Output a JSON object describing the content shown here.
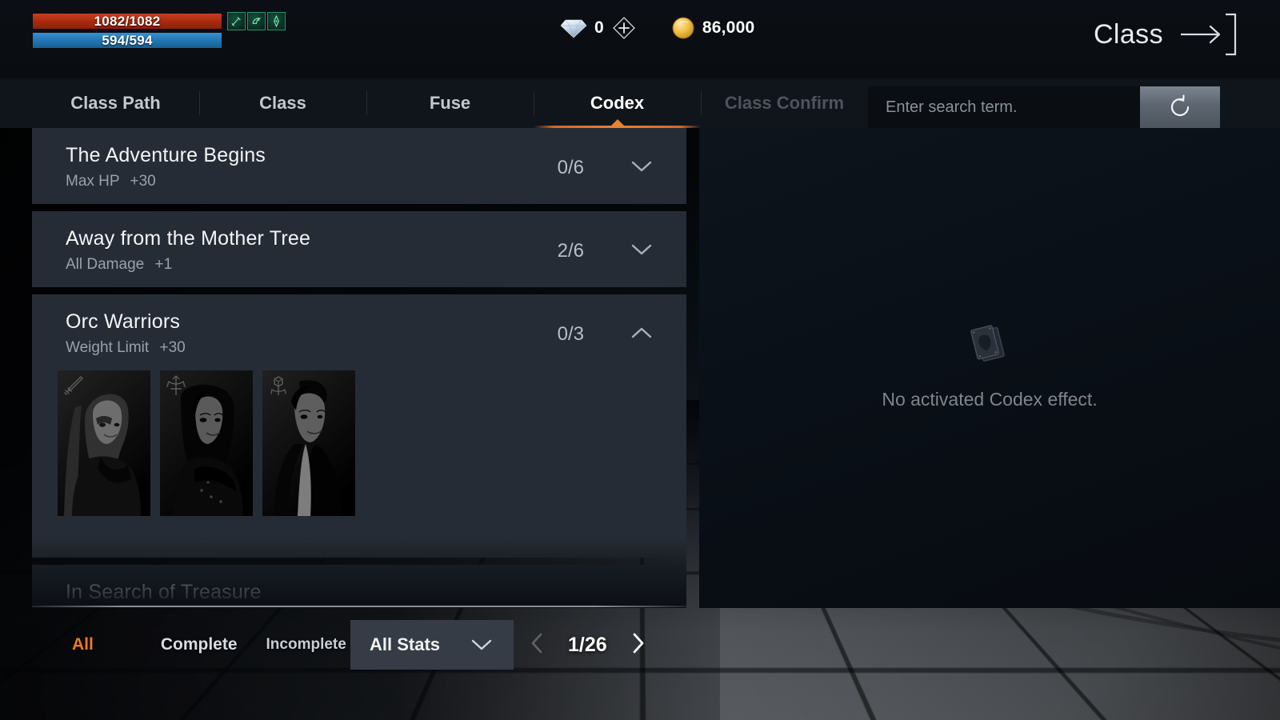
{
  "hud": {
    "hp": {
      "label": "1082/1082",
      "current": 1082,
      "max": 1082,
      "color": "#a92a10"
    },
    "mp": {
      "label": "594/594",
      "current": 594,
      "max": 594,
      "color": "#2076b4"
    },
    "buffs": [
      {
        "name": "buff-icon-1"
      },
      {
        "name": "buff-icon-2"
      },
      {
        "name": "buff-icon-3"
      }
    ],
    "currency": {
      "gem": {
        "icon": "diamond-icon",
        "value": "0"
      },
      "add_gem": {
        "icon": "plus-icon"
      },
      "gold": {
        "icon": "coin-icon",
        "value": "86,000"
      }
    },
    "exit": {
      "label": "Class",
      "icon": "arrow-right-icon"
    }
  },
  "tabs": [
    {
      "label": "Class Path",
      "state": "normal"
    },
    {
      "label": "Class",
      "state": "normal"
    },
    {
      "label": "Fuse",
      "state": "normal"
    },
    {
      "label": "Codex",
      "state": "active"
    },
    {
      "label": "Class Confirm",
      "state": "disabled"
    }
  ],
  "search": {
    "placeholder": "Enter search term.",
    "value": "",
    "reset_icon": "refresh-icon"
  },
  "codex_list": [
    {
      "title": "The Adventure Begins",
      "stat_label": "Max HP",
      "stat_value": "+30",
      "count": "0/6",
      "expanded": false,
      "chevron": "chevron-down-icon",
      "cards": []
    },
    {
      "title": "Away from the Mother Tree",
      "stat_label": "All Damage",
      "stat_value": "+1",
      "count": "2/6",
      "expanded": false,
      "chevron": "chevron-down-icon",
      "cards": []
    },
    {
      "title": "Orc Warriors",
      "stat_label": "Weight Limit",
      "stat_value": "+30",
      "count": "0/3",
      "expanded": true,
      "chevron": "chevron-up-icon",
      "cards": [
        {
          "icon": "sword-icon",
          "locked": true
        },
        {
          "icon": "bow-icon",
          "locked": true
        },
        {
          "icon": "staff-icon",
          "locked": true
        }
      ]
    },
    {
      "title": "In Search of Treasure",
      "stat_label": "",
      "stat_value": "",
      "count": "",
      "expanded": false,
      "chevron": "chevron-down-icon",
      "cards": []
    }
  ],
  "effect_panel": {
    "icon": "codex-cards-icon",
    "empty_text": "No activated Codex effect."
  },
  "bottom": {
    "filters": [
      {
        "label": "All",
        "active": true
      },
      {
        "label": "Complete",
        "active": false
      },
      {
        "label": "Incomplete",
        "active": false
      }
    ],
    "stat_filter": {
      "label": "All Stats",
      "icon": "chevron-down-icon"
    },
    "pager": {
      "prev_icon": "chevron-left-icon",
      "page": "1/26",
      "next_icon": "chevron-right-icon"
    }
  },
  "theme": {
    "accent": "#f07a1e",
    "tab_underline": "#e8822f",
    "hp": "#a92a10",
    "mp": "#2076b4",
    "row_bg": "#262c36",
    "panel_bg": "#0a1018"
  }
}
